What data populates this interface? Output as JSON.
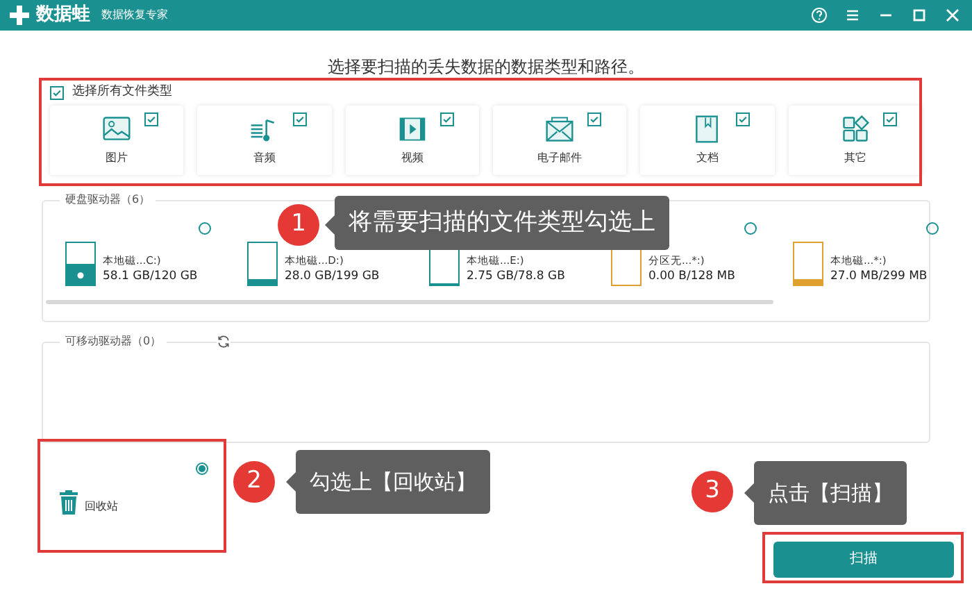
{
  "window": {
    "app_name": "数据蛙",
    "subtitle": "数据恢复专家"
  },
  "heading": "选择要扫描的丢失数据的数据类型和路径。",
  "file_types": {
    "select_all": {
      "label": "选择所有文件类型",
      "checked": true
    },
    "items": [
      {
        "kind": "image",
        "label": "图片",
        "checked": true
      },
      {
        "kind": "audio",
        "label": "音频",
        "checked": true
      },
      {
        "kind": "video",
        "label": "视频",
        "checked": true
      },
      {
        "kind": "email",
        "label": "电子邮件",
        "checked": true
      },
      {
        "kind": "document",
        "label": "文档",
        "checked": true
      },
      {
        "kind": "other",
        "label": "其它",
        "checked": true
      }
    ]
  },
  "disk_drives": {
    "title": "硬盘驱动器（6）",
    "drives": [
      {
        "kind": "system",
        "name": "本地磁...C:)",
        "usage": "58.1 GB/120 GB",
        "level": 0.5,
        "color": "#1a9090",
        "selected": false
      },
      {
        "kind": "disk",
        "name": "本地磁...D:)",
        "usage": "28.0 GB/199 GB",
        "level": 0.15,
        "color": "#1a9090"
      },
      {
        "kind": "disk",
        "name": "本地磁...E:)",
        "usage": "2.75 GB/78.8 GB",
        "level": 0.05,
        "color": "#1a9090"
      },
      {
        "kind": "disk",
        "name": "分区无...*:)",
        "usage": "0.00  B/128 MB",
        "level": 0,
        "color": "#e0a030",
        "selected": false
      },
      {
        "kind": "disk",
        "name": "本地磁...*:)",
        "usage": "27.0 MB/299 MB",
        "level": 0.15,
        "color": "#e0a030",
        "selected": false
      }
    ]
  },
  "removable": {
    "title": "可移动驱动器（0）"
  },
  "recycle_bin": {
    "label": "回收站",
    "selected": true
  },
  "annotations": [
    {
      "number": "1",
      "text": "将需要扫描的文件类型勾选上"
    },
    {
      "number": "2",
      "text": "勾选上【回收站】"
    },
    {
      "number": "3",
      "text": "点击【扫描】"
    }
  ],
  "scan_button": "扫描"
}
